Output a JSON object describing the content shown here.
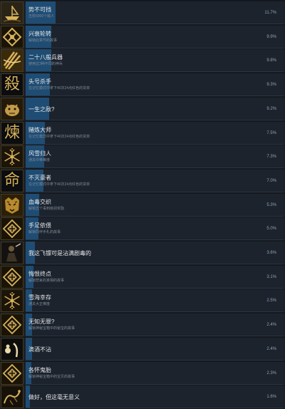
{
  "achievements": [
    {
      "title": "势不可挡",
      "desc": "击败5000个敌人",
      "percent": "11.7%",
      "rate": 11.7,
      "icon": "ship-icon",
      "glyph": "",
      "single": false
    },
    {
      "title": "兴衰轮转",
      "desc": "解锁此章节的故事",
      "percent": "9.9%",
      "rate": 9.9,
      "icon": "gold-emblem-icon",
      "glyph": "",
      "single": false
    },
    {
      "title": "二十八般兵器",
      "desc": "使用过3种不同的神兵",
      "percent": "9.8%",
      "rate": 9.8,
      "icon": "weapon-icon",
      "glyph": "",
      "single": false
    },
    {
      "title": "头号杀手",
      "desc": "在记忆模式中拿下40次24点红色的货单",
      "percent": "9.3%",
      "rate": 9.3,
      "icon": "kill-glyph-icon",
      "glyph": "殺",
      "single": false
    },
    {
      "title": "一生之敌?",
      "desc": "",
      "percent": "9.2%",
      "rate": 9.2,
      "icon": "beast-icon",
      "glyph": "",
      "single": true
    },
    {
      "title": "赌炼大师",
      "desc": "在记忆模式中拿下40次24点红色的货单",
      "percent": "7.5%",
      "rate": 7.5,
      "icon": "forge-glyph-icon",
      "glyph": "煉",
      "single": false
    },
    {
      "title": "风雪归人",
      "desc": "通关中等难度",
      "percent": "7.3%",
      "rate": 7.3,
      "icon": "snowflake-icon",
      "glyph": "",
      "single": false
    },
    {
      "title": "不灭豪者",
      "desc": "在记忆模式中拿下40次24点红色的货单",
      "percent": "7.0%",
      "rate": 7.0,
      "icon": "fate-glyph-icon",
      "glyph": "命",
      "single": false
    },
    {
      "title": "血毒交织",
      "desc": "解锁五个毒刺级别奖励",
      "percent": "5.3%",
      "rate": 5.3,
      "icon": "tiger-icon",
      "glyph": "",
      "single": false
    },
    {
      "title": "手足依偎",
      "desc": "解锁同伴手札的故事",
      "percent": "5.0%",
      "rate": 5.0,
      "icon": "gold-diamond-icon",
      "glyph": "",
      "single": false
    },
    {
      "title": "我这飞镖可是沾满剧毒的",
      "desc": "",
      "percent": "3.6%",
      "rate": 3.6,
      "icon": "warrior-icon",
      "glyph": "",
      "single": true
    },
    {
      "title": "悔恨终点",
      "desc": "解锁悲哀的真相的故事",
      "percent": "3.1%",
      "rate": 3.1,
      "icon": "gold-diamond-icon",
      "glyph": "",
      "single": false
    },
    {
      "title": "雪海幸存",
      "desc": "通关大正难度",
      "percent": "2.5%",
      "rate": 2.5,
      "icon": "snowflake-icon",
      "glyph": "",
      "single": false
    },
    {
      "title": "无知无罪?",
      "desc": "解锁神秘宝箱中的秘宝的故事",
      "percent": "2.4%",
      "rate": 2.4,
      "icon": "gold-diamond-icon",
      "glyph": "",
      "single": false
    },
    {
      "title": "滴酒不沾",
      "desc": "",
      "percent": "2.4%",
      "rate": 2.4,
      "icon": "gourd-icon",
      "glyph": "",
      "single": true
    },
    {
      "title": "各怀鬼胎",
      "desc": "解锁神秘宝箱中的宝贝的故事",
      "percent": "2.3%",
      "rate": 2.3,
      "icon": "gold-diamond-icon",
      "glyph": "",
      "single": false
    },
    {
      "title": "做好，但这毫无意义",
      "desc": "",
      "percent": "1.6%",
      "rate": 1.6,
      "icon": "dragon-icon",
      "glyph": "",
      "single": true
    }
  ],
  "colors": {
    "bar_fill": "#1f4c73",
    "bar_track": "#1c232d",
    "gold": "#d8b25c"
  }
}
